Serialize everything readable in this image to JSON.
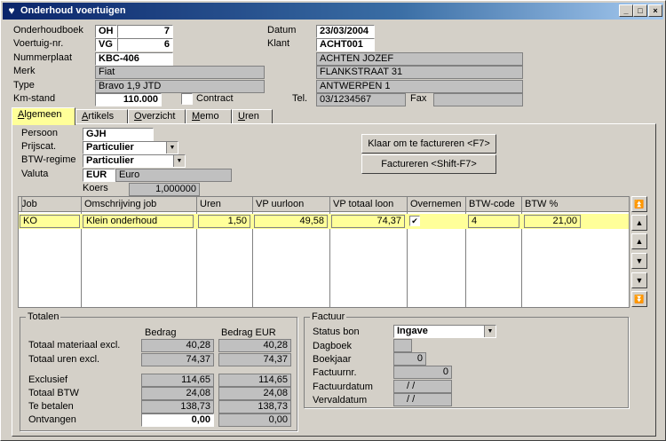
{
  "window": {
    "title": "Onderhoud voertuigen",
    "app_icon": "heart-shield-icon",
    "min_glyph": "_",
    "max_glyph": "□",
    "close_glyph": "×"
  },
  "header": {
    "onderhoudboek_label": "Onderhoudboek",
    "onderhoudboek_code": "OH",
    "onderhoudboek_nr": "7",
    "voertuignr_label": "Voertuig-nr.",
    "voertuignr_code": "VG",
    "voertuignr_nr": "6",
    "nummerplaat_label": "Nummerplaat",
    "nummerplaat": "KBC-406",
    "merk_label": "Merk",
    "merk": "Fiat",
    "type_label": "Type",
    "type": "Bravo 1,9 JTD",
    "kmstand_label": "Km-stand",
    "kmstand": "110.000",
    "contract_label": "Contract",
    "datum_label": "Datum",
    "datum": "23/03/2004",
    "klant_label": "Klant",
    "klant": "ACHT001",
    "klant_naam": "ACHTEN JOZEF",
    "klant_adres": "FLANKSTRAAT 31",
    "klant_plaats": "ANTWERPEN 1",
    "tel_label": "Tel.",
    "tel": "03/1234567",
    "fax_label": "Fax",
    "fax": ""
  },
  "tabs": [
    {
      "label": "Algemeen",
      "ul": "A",
      "rest": "lgemeen"
    },
    {
      "label": "Artikels",
      "ul": "A",
      "rest": "rtikels"
    },
    {
      "label": "Overzicht",
      "ul": "O",
      "rest": "verzicht"
    },
    {
      "label": "Memo",
      "ul": "M",
      "rest": "emo"
    },
    {
      "label": "Uren",
      "ul": "U",
      "rest": "ren"
    }
  ],
  "algemeen": {
    "persoon_label": "Persoon",
    "persoon": "GJH",
    "prijscat_label": "Prijscat.",
    "prijscat": "Particulier",
    "btw_label": "BTW-regime",
    "btw": "Particulier",
    "valuta_label": "Valuta",
    "valuta_code": "EUR",
    "valuta_naam": "Euro",
    "koers_label": "Koers",
    "koers": "1,000000",
    "btn_klaar": "Klaar om te factureren <F7>",
    "btn_factureren": "Factureren <Shift-F7>"
  },
  "grid": {
    "columns": [
      "Job",
      "Omschrijving job",
      "Uren",
      "VP uurloon",
      "VP totaal loon",
      "Overnemen",
      "BTW-code",
      "BTW %"
    ],
    "row": {
      "job": "KO",
      "omschrijving": "Klein onderhoud",
      "uren": "1,50",
      "vp_uurloon": "49,58",
      "vp_totaal": "74,37",
      "overnemen": "✔",
      "btw_code": "4",
      "btw_pct": "21,00"
    }
  },
  "scroll": {
    "first": "⏫",
    "prev_page": "▲",
    "up": "▲",
    "down": "▼",
    "next_page": "▼",
    "last": "⏬"
  },
  "totalen": {
    "title": "Totalen",
    "col1": "Bedrag",
    "col2": "Bedrag EUR",
    "rows": [
      {
        "label": "Totaal materiaal excl.",
        "v1": "40,28",
        "v2": "40,28"
      },
      {
        "label": "Totaal uren excl.",
        "v1": "74,37",
        "v2": "74,37"
      },
      {
        "label": "Exclusief",
        "v1": "114,65",
        "v2": "114,65"
      },
      {
        "label": "Totaal BTW",
        "v1": "24,08",
        "v2": "24,08"
      },
      {
        "label": "Te betalen",
        "v1": "138,73",
        "v2": "138,73"
      },
      {
        "label": "Ontvangen",
        "v1": "0,00",
        "v2": "0,00"
      }
    ]
  },
  "factuur": {
    "title": "Factuur",
    "status_label": "Status bon",
    "status": "Ingave",
    "dagboek_label": "Dagboek",
    "dagboek": "",
    "boekjaar_label": "Boekjaar",
    "boekjaar": "0",
    "factuurnr_label": "Factuurnr.",
    "factuurnr": "0",
    "factuurdatum_label": "Factuurdatum",
    "factuurdatum": "/ /",
    "vervaldatum_label": "Vervaldatum",
    "vervaldatum": "/ /"
  }
}
